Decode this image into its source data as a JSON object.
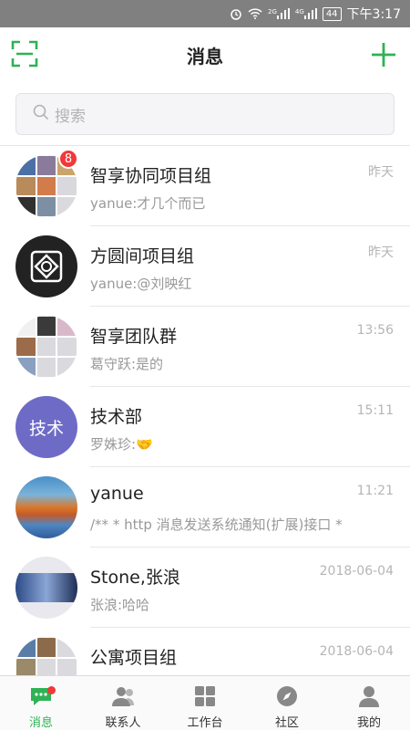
{
  "status_bar": {
    "time": "下午3:17",
    "battery": "44",
    "network_a": "2G",
    "network_b": "4G"
  },
  "header": {
    "title": "消息",
    "scan_icon": "scan-icon",
    "add_icon": "plus-icon",
    "accent": "#2fb255"
  },
  "search": {
    "placeholder": "搜索"
  },
  "conversations": [
    {
      "name": "智享协同项目组",
      "preview": "yanue:才几个而已",
      "time": "昨天",
      "badge": "8"
    },
    {
      "name": "方圆间项目组",
      "preview": "yanue:@刘映红",
      "time": "昨天"
    },
    {
      "name": "智享团队群",
      "preview": "葛守跃:是的",
      "time": "13:56"
    },
    {
      "name": "技术部",
      "preview": "罗姝珍:🤝",
      "time": "15:11",
      "avatar_text": "技术"
    },
    {
      "name": "yanue",
      "preview": "/**      * http 消息发送系统通知(扩展)接口      * ",
      "time": "11:21"
    },
    {
      "name": "Stone,张浪",
      "preview": "张浪:哈哈",
      "time": "2018-06-04"
    },
    {
      "name": "公寓项目组",
      "preview": "",
      "time": "2018-06-04"
    }
  ],
  "tabs": [
    {
      "label": "消息",
      "icon": "chat-icon",
      "active": true
    },
    {
      "label": "联系人",
      "icon": "contacts-icon"
    },
    {
      "label": "工作台",
      "icon": "workbench-icon"
    },
    {
      "label": "社区",
      "icon": "compass-icon"
    },
    {
      "label": "我的",
      "icon": "person-icon"
    }
  ]
}
